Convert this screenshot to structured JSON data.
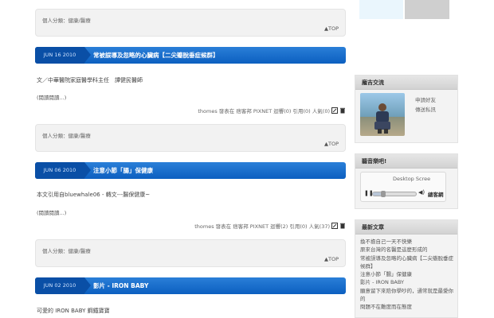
{
  "posts": [
    {
      "category_top": "個人分類：健康/醫療",
      "top_label": "▲TOP"
    },
    {
      "date": "JUN 16 2010",
      "title": "常被誤導及忽略的心臟病【二尖瓣脫垂症候群】",
      "body": "文／中華醫院家庭醫學科主任　譚健民醫師",
      "read_more": "(閱讀閱讀...)",
      "meta": "thomes 發表在 痞客邦 PIXNET 迴響(0) 引用(0) 人氣(0)",
      "category": "個人分類：健康/醫療",
      "top_label": "▲TOP"
    },
    {
      "date": "JUN 06 2010",
      "title": "注意小節「腸」保健康",
      "body": "本文引用自bluewhale06 - 轉文---腸保健康~",
      "read_more": "(閱讀閱讀...)",
      "meta": "thomes 發表在 痞客邦 PIXNET 迴響(2) 引用(0) 人氣(37)",
      "category": "個人分類：健康/醫療",
      "top_label": "▲TOP"
    },
    {
      "date": "JUN 02 2010",
      "title": "影片 - IRON BABY",
      "body": "可愛的 IRON BABY 鋼鐵寶寶"
    }
  ],
  "sidebar": {
    "profile": {
      "title": "龐吉交流",
      "links": [
        "申請好友",
        "傳送私訊"
      ]
    },
    "music": {
      "title": "聽音樂吧!",
      "player_label": "Desktop Scree",
      "brand": "總客網"
    },
    "recent": {
      "title": "最新文章",
      "items": [
        "換不擔自己一天不快樂",
        "原來台灣的名醫是這麼形成的",
        "常被誤導及忽略的心臟病【二尖瓣脫垂症候群】",
        "注意小節「腸」保健康",
        "影片 - IRON BABY",
        "願意留下來陪你學吵的，通常就是最愛你的",
        "問題不在難度而在態度"
      ]
    }
  },
  "colors": {
    "header_blue": "#1a6fd0",
    "date_blue": "#0a4fa6"
  }
}
